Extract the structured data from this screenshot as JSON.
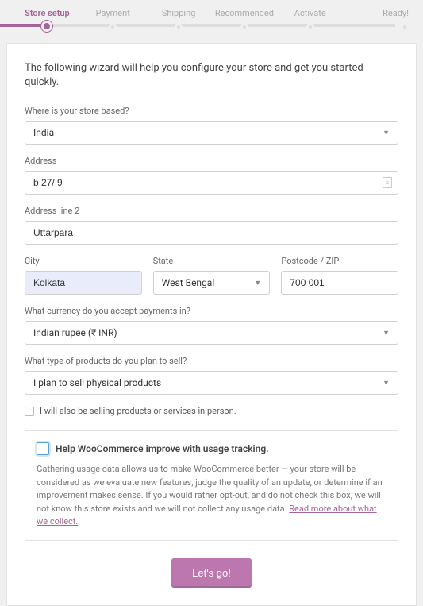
{
  "stepper": {
    "steps": [
      "Store setup",
      "Payment",
      "Shipping",
      "Recommended",
      "Activate",
      "Ready!"
    ],
    "active_index": 0
  },
  "intro": "The following wizard will help you configure your store and get you started quickly.",
  "store_location": {
    "label": "Where is your store based?",
    "value": "India"
  },
  "address": {
    "label": "Address",
    "value": "b 27/ 9"
  },
  "address2": {
    "label": "Address line 2",
    "value": "Uttarpara"
  },
  "city": {
    "label": "City",
    "value": "Kolkata"
  },
  "state": {
    "label": "State",
    "value": "West Bengal"
  },
  "postcode": {
    "label": "Postcode / ZIP",
    "value": "700 001"
  },
  "currency": {
    "label": "What currency do you accept payments in?",
    "value": "Indian rupee (₹ INR)"
  },
  "product_type": {
    "label": "What type of products do you plan to sell?",
    "value": "I plan to sell physical products"
  },
  "in_person": {
    "label": "I will also be selling products or services in person."
  },
  "tracking": {
    "title": "Help WooCommerce improve with usage tracking.",
    "text": "Gathering usage data allows us to make WooCommerce better — your store will be considered as we evaluate new features, judge the quality of an update, or determine if an improvement makes sense. If you would rather opt-out, and do not check this box, we will not know this store exists and we will not collect any usage data. ",
    "link": "Read more about what we collect."
  },
  "submit": {
    "label": "Let's go!"
  }
}
